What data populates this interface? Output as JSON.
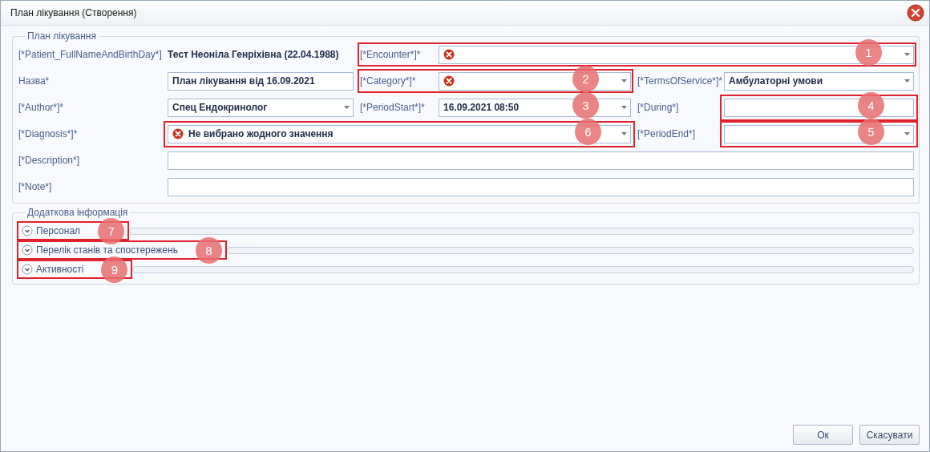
{
  "window": {
    "title": "План лікування (Створення)"
  },
  "main_group": {
    "title": "План лікування",
    "rows": [
      [
        {
          "label": "[*Patient_FullNameAndBirthDay*]",
          "field": {
            "kind": "value",
            "value": "Тест Неоніла Генріхівна (22.04.1988)"
          }
        },
        {
          "label": "[*Encounter*]*",
          "field": {
            "kind": "combo",
            "error": true
          },
          "marker": {
            "number": "1",
            "framed": true
          }
        }
      ],
      [
        {
          "label": "Назва*",
          "field": {
            "kind": "input",
            "value": "План лікування від 16.09.2021"
          }
        },
        {
          "label": "[*Category*]*",
          "field": {
            "kind": "combo",
            "error": true
          },
          "marker": {
            "number": "2",
            "framed": true
          }
        },
        {
          "label": "[*TermsOfService*]*",
          "field": {
            "kind": "combo",
            "value": "Амбулаторні умови"
          }
        }
      ],
      [
        {
          "label": "[*Author*]*",
          "field": {
            "kind": "combo",
            "value": "Спец Ендокринолог"
          }
        },
        {
          "label": "[*PeriodStart*]*",
          "field": {
            "kind": "combo",
            "value": "16.09.2021 08:50"
          },
          "marker": {
            "number": "3",
            "framed": false
          }
        },
        {
          "label": "[*During*]",
          "field": {
            "kind": "input"
          },
          "marker": {
            "number": "4",
            "framed": true
          }
        }
      ],
      [
        {
          "label": "[*Diagnosis*]*",
          "field": {
            "kind": "combo",
            "error": true,
            "value": "Не вибрано жодного значення"
          },
          "marker": {
            "number": "6",
            "framed": true
          }
        },
        {
          "label": "[*PeriodEnd*]",
          "field": {
            "kind": "combo"
          },
          "marker": {
            "number": "5",
            "framed": true
          }
        }
      ],
      [
        {
          "label": "[*Description*]",
          "field": {
            "kind": "input"
          }
        }
      ],
      [
        {
          "label": "[*Note*]",
          "field": {
            "kind": "input"
          }
        }
      ]
    ]
  },
  "extra_group": {
    "title": "Додаткова інформація",
    "sections": [
      {
        "title": "Персонал",
        "expanded": false,
        "marker": {
          "number": "7",
          "framed": true
        }
      },
      {
        "title": "Перелік станів та спостережень",
        "expanded": false,
        "marker": {
          "number": "8",
          "framed": true
        }
      },
      {
        "title": "Активності",
        "expanded": false,
        "marker": {
          "number": "9",
          "framed": true
        }
      }
    ]
  },
  "buttons": [
    "Ок",
    "Скасувати"
  ]
}
